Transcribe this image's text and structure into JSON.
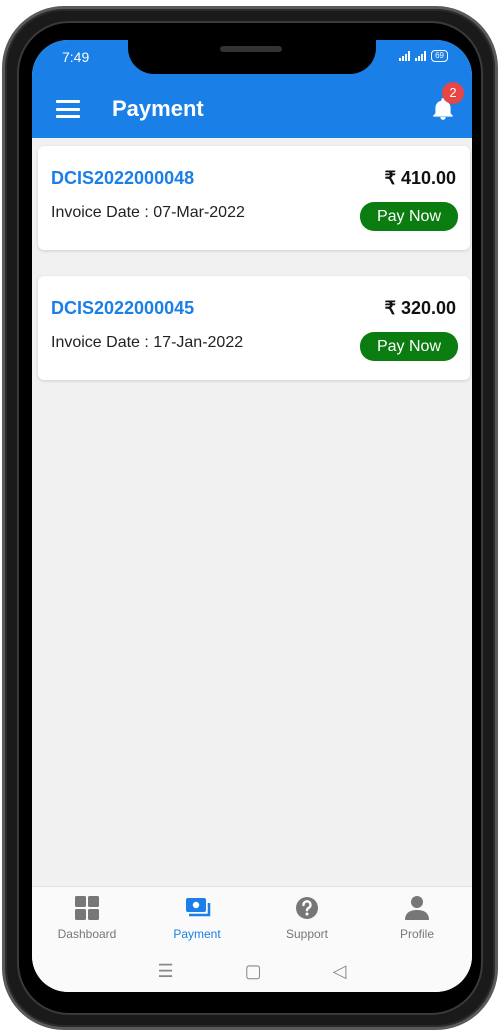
{
  "status": {
    "time": "7:49",
    "battery": "69"
  },
  "header": {
    "title": "Payment",
    "notification_count": "2"
  },
  "invoices": [
    {
      "number": "DCIS2022000048",
      "amount": "₹ 410.00",
      "date": "Invoice Date : 07-Mar-2022",
      "action": "Pay Now"
    },
    {
      "number": "DCIS2022000045",
      "amount": "₹ 320.00",
      "date": "Invoice Date : 17-Jan-2022",
      "action": "Pay Now"
    }
  ],
  "bottom_nav": [
    {
      "label": "Dashboard",
      "icon": "dashboard-icon"
    },
    {
      "label": "Payment",
      "icon": "payment-icon"
    },
    {
      "label": "Support",
      "icon": "support-icon"
    },
    {
      "label": "Profile",
      "icon": "profile-icon"
    }
  ],
  "colors": {
    "primary": "#1a7fe6",
    "pay_button": "#0b7d10",
    "badge": "#e84545",
    "background": "#f1f1f1"
  },
  "system_nav": {
    "menu": "☰",
    "home": "▢",
    "back": "◁"
  }
}
